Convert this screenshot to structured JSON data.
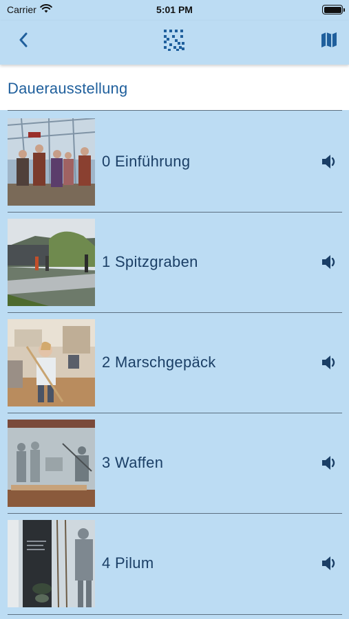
{
  "status_bar": {
    "carrier": "Carrier",
    "time": "5:01 PM"
  },
  "nav": {
    "back_icon": "chevron-left-icon",
    "center_icon": "qr-code-icon",
    "right_icon": "map-icon"
  },
  "section": {
    "title": "Dauerausstellung"
  },
  "items": [
    {
      "label": "0 Einführung",
      "icon": "speaker-icon"
    },
    {
      "label": "1 Spitzgraben",
      "icon": "speaker-icon"
    },
    {
      "label": "2 Marschgepäck",
      "icon": "speaker-icon"
    },
    {
      "label": "3 Waffen",
      "icon": "speaker-icon"
    },
    {
      "label": "4 Pilum",
      "icon": "speaker-icon"
    }
  ],
  "colors": {
    "background": "#bcdcf3",
    "accent": "#1f5f9c",
    "text": "#1b3f66"
  }
}
